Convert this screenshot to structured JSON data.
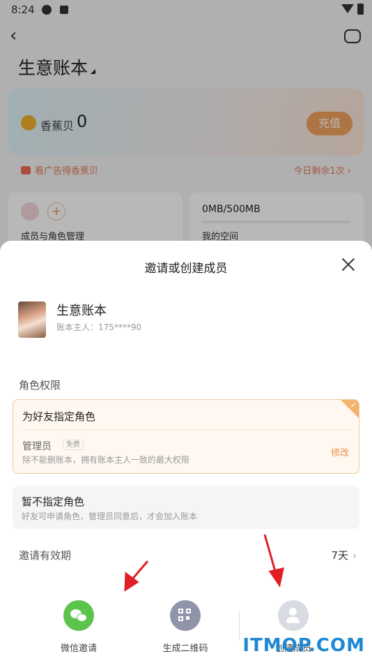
{
  "status_bar": {
    "time": "8:24"
  },
  "background": {
    "title": "生意账本",
    "coin_label": "香蕉贝",
    "coin_value": "0",
    "recharge_label": "充值",
    "ad_text": "看广告得香蕉贝",
    "ad_remaining": "今日剩余1次 ›",
    "member_tile_label": "成员与角色管理",
    "storage_value": "0MB/500MB",
    "storage_label": "我的空间"
  },
  "sheet": {
    "title": "邀请或创建成员",
    "book_name": "生意账本",
    "book_owner": "账本主人：175****90",
    "section_role": "角色权限",
    "assign_role_title": "为好友指定角色",
    "role_name": "管理员",
    "role_badge": "免费",
    "role_desc": "除不能删账本，拥有账本主人一致的最大权限",
    "modify_label": "修改",
    "no_role_title": "暂不指定角色",
    "no_role_desc": "好友可申请角色，管理员同意后，才会加入账本",
    "validity_label": "邀请有效期",
    "validity_value": "7天",
    "actions": [
      {
        "label": "微信邀请",
        "icon": "wechat-icon"
      },
      {
        "label": "生成二维码",
        "icon": "qr-code-icon"
      },
      {
        "label": "创建成员",
        "icon": "add-person-icon"
      }
    ]
  },
  "annotation_color": "#e21f26",
  "watermark": "ITMOP.COM"
}
